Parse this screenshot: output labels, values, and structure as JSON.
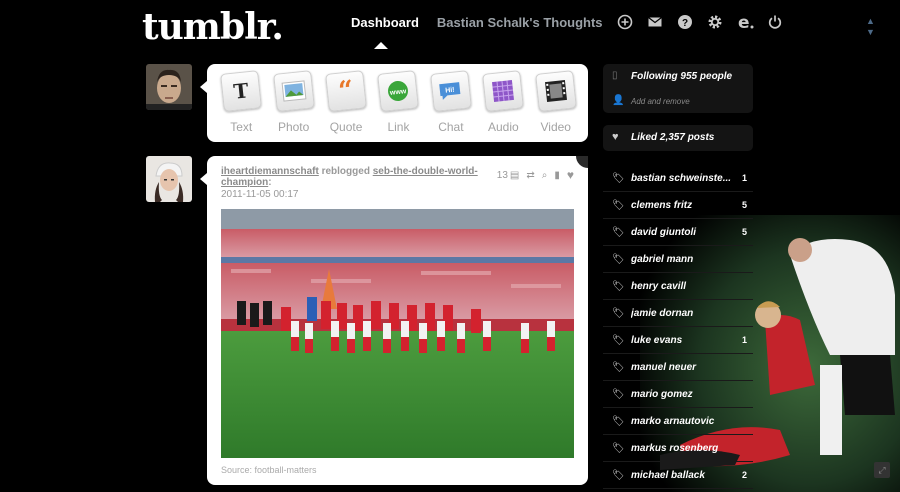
{
  "header": {
    "logo": "tumblr.",
    "nav": {
      "dashboard": "Dashboard",
      "blog": "Bastian Schalk's Thoughts"
    },
    "icons": [
      "plus-circle-icon",
      "mail-icon",
      "help-icon",
      "gear-icon",
      "e-icon",
      "power-icon"
    ]
  },
  "composer": {
    "types": [
      {
        "label": "Text",
        "icon": "text-icon"
      },
      {
        "label": "Photo",
        "icon": "photo-icon"
      },
      {
        "label": "Quote",
        "icon": "quote-icon"
      },
      {
        "label": "Link",
        "icon": "link-icon"
      },
      {
        "label": "Chat",
        "icon": "chat-icon"
      },
      {
        "label": "Audio",
        "icon": "audio-icon"
      },
      {
        "label": "Video",
        "icon": "video-icon"
      }
    ]
  },
  "post": {
    "author": "iheartdiemannschaft",
    "action": "reblogged",
    "source_blog": "seb-the-double-world-champion",
    "date": "2011-11-05 00:17",
    "note_count": "13",
    "source": "Source: football-matters"
  },
  "sidebar": {
    "following": "Following 955 people",
    "add_remove": "Add and remove",
    "liked": "Liked 2,357 posts",
    "tags": [
      {
        "name": "bastian schweinste...",
        "count": "1"
      },
      {
        "name": "clemens fritz",
        "count": "5"
      },
      {
        "name": "david giuntoli",
        "count": "5"
      },
      {
        "name": "gabriel mann",
        "count": ""
      },
      {
        "name": "henry cavill",
        "count": ""
      },
      {
        "name": "jamie dornan",
        "count": ""
      },
      {
        "name": "luke evans",
        "count": "1"
      },
      {
        "name": "manuel neuer",
        "count": ""
      },
      {
        "name": "mario gomez",
        "count": ""
      },
      {
        "name": "marko arnautovic",
        "count": ""
      },
      {
        "name": "markus rosenberg",
        "count": ""
      },
      {
        "name": "michael ballack",
        "count": "2"
      }
    ]
  },
  "colors": {
    "background": "#000000",
    "card": "#ffffff",
    "accent_nav_dim": "#9aa0a6"
  }
}
